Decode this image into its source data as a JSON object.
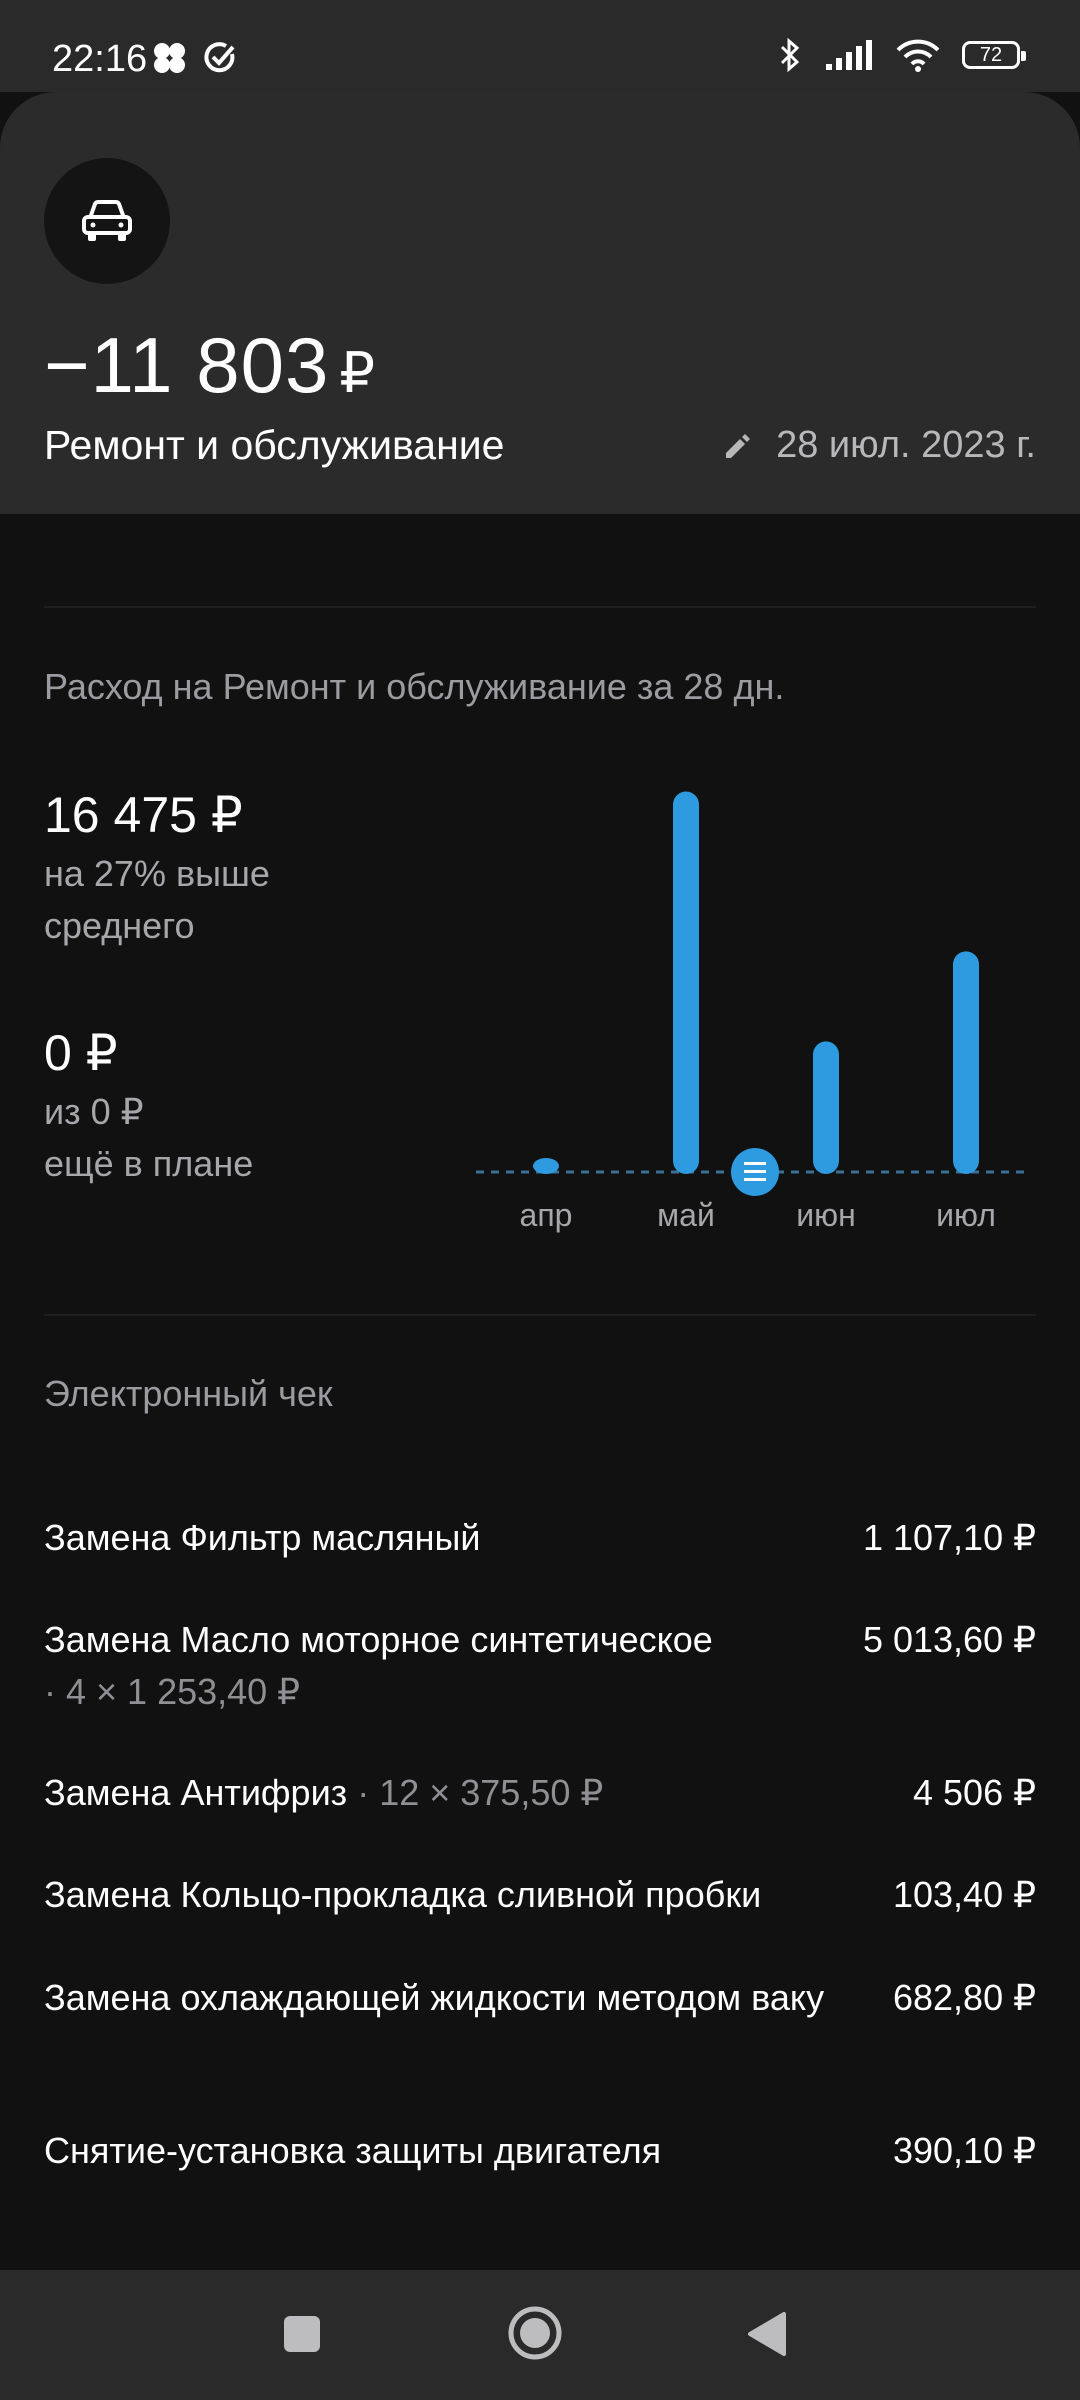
{
  "status_bar": {
    "time": "22:16",
    "battery": "72"
  },
  "header": {
    "category_icon": "car-icon",
    "amount": "−11 803",
    "currency": "₽",
    "category": "Ремонт и обслуживание",
    "date": "28 июл. 2023 г."
  },
  "spending": {
    "title": "Расход на Ремонт и обслуживание за 28 дн.",
    "total": "16 475 ₽",
    "compare_line1": "на 27% выше",
    "compare_line2": "среднего",
    "plan_value": "0 ₽",
    "plan_line1": "из 0 ₽",
    "plan_line2": "ещё в плане"
  },
  "chart_data": {
    "type": "bar",
    "categories": [
      "апр",
      "май",
      "июн",
      "июл"
    ],
    "values": [
      350,
      16900,
      5800,
      9800
    ],
    "ylim": [
      0,
      17500
    ],
    "average_marker": true,
    "color": "#2e9be0"
  },
  "receipt": {
    "title": "Электронный чек",
    "items": [
      {
        "name": "Замена Фильтр масляный",
        "qty": "",
        "price": "1 107,10 ₽"
      },
      {
        "name": "Замена Масло моторное синтетическое",
        "qty": "· 4 × 1 253,40 ₽",
        "price": "5 013,60 ₽"
      },
      {
        "name": "Замена Антифриз",
        "qty": "· 12 × 375,50 ₽",
        "price": "4 506 ₽"
      },
      {
        "name": "Замена Кольцо-прокладка сливной пробки",
        "qty": "",
        "price": "103,40 ₽"
      },
      {
        "name": "Замена охлаждающей жидкости методом ваку",
        "qty": "",
        "price": "682,80 ₽"
      },
      {
        "name": "Снятие-установка защиты двигателя",
        "qty": "",
        "price": "390,10 ₽"
      }
    ]
  },
  "nav": {
    "recents_icon": "square-icon",
    "home_icon": "circle-icon",
    "back_icon": "triangle-back-icon"
  }
}
